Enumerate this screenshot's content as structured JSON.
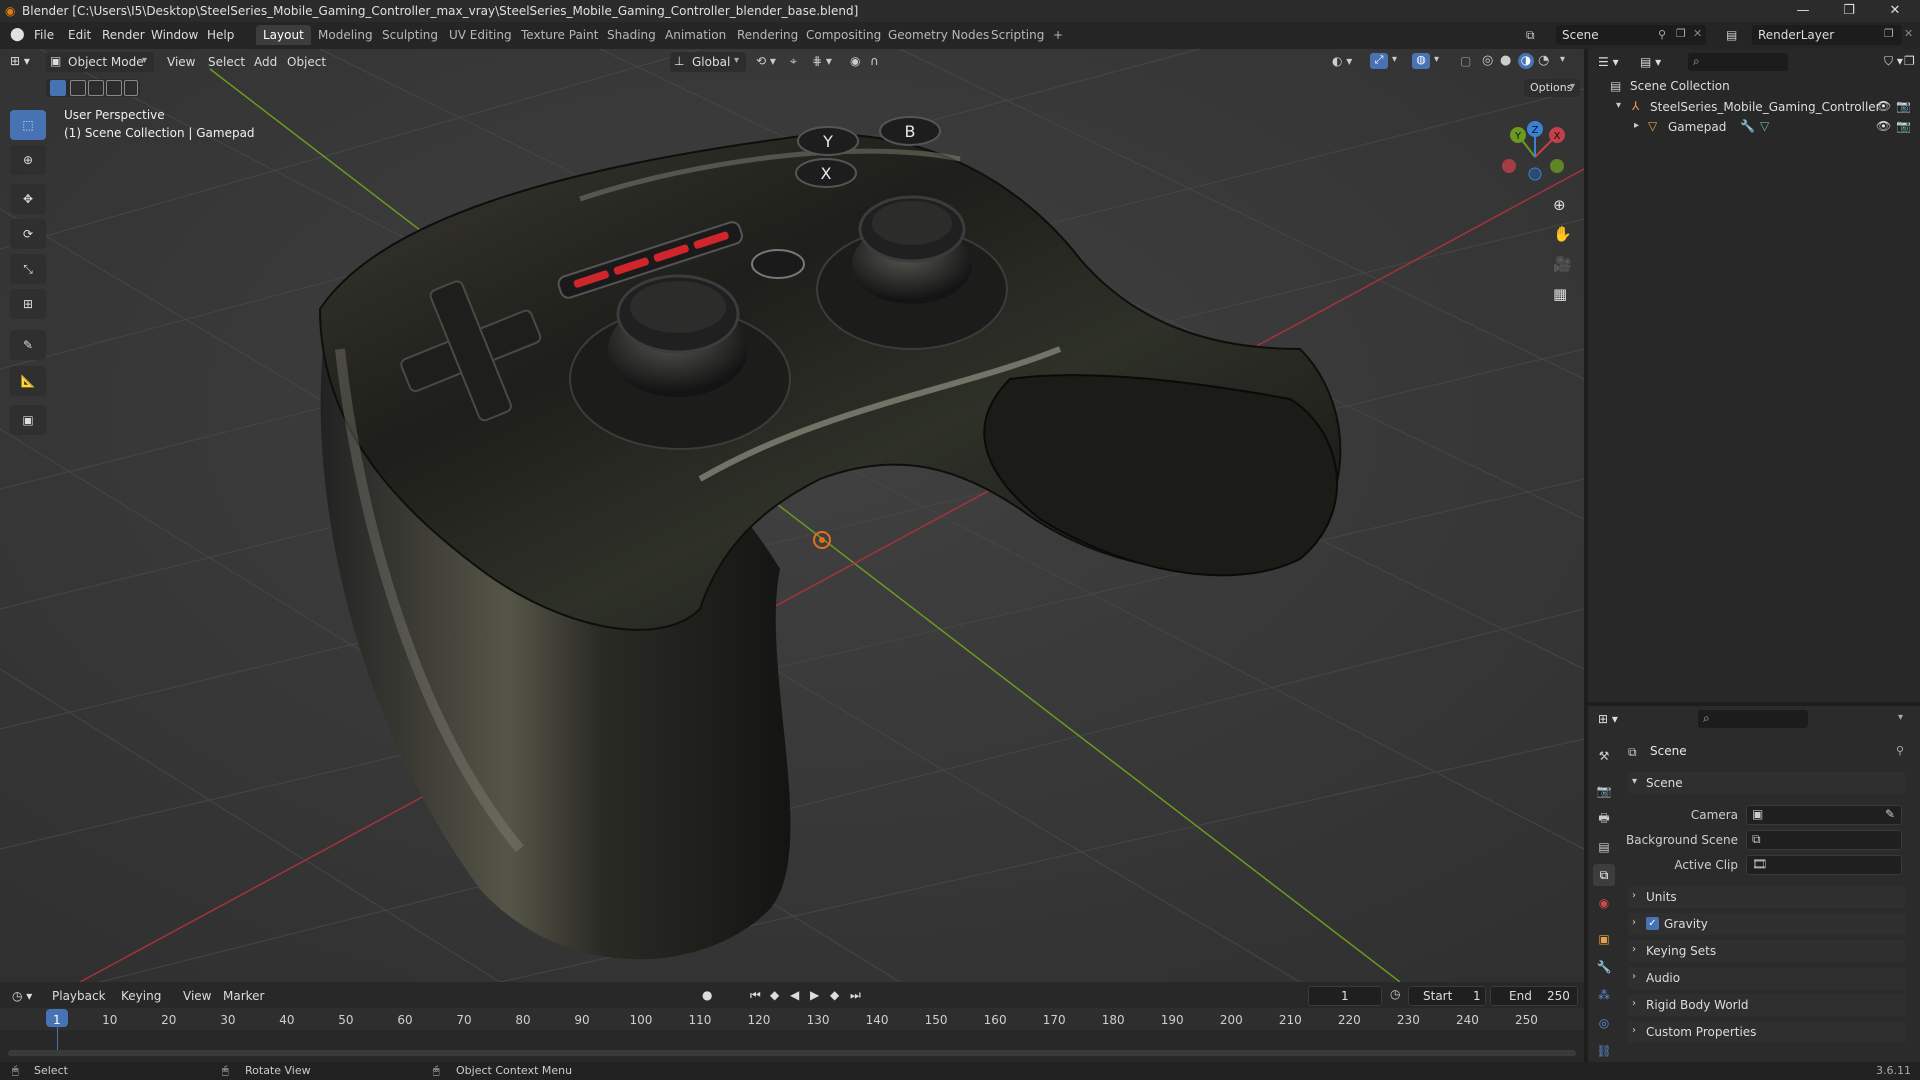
{
  "window": {
    "title": "Blender [C:\\Users\\I5\\Desktop\\SteelSeries_Mobile_Gaming_Controller_max_vray\\SteelSeries_Mobile_Gaming_Controller_blender_base.blend]",
    "minimize": "—",
    "maximize": "❐",
    "close": "✕"
  },
  "menu": [
    "File",
    "Edit",
    "Render",
    "Window",
    "Help"
  ],
  "workspaces": [
    "Layout",
    "Modeling",
    "Sculpting",
    "UV Editing",
    "Texture Paint",
    "Shading",
    "Animation",
    "Rendering",
    "Compositing",
    "Geometry Nodes",
    "Scripting"
  ],
  "add_workspace": "+",
  "scene_selector": {
    "label": "Scene"
  },
  "view_layer_selector": {
    "label": "RenderLayer"
  },
  "viewport": {
    "mode": "Object Mode",
    "menus": [
      "View",
      "Select",
      "Add",
      "Object"
    ],
    "transform_orientation": "Global",
    "options": "Options",
    "overlay_text_1": "User Perspective",
    "overlay_text_2": "(1) Scene Collection | Gamepad",
    "gizmo": {
      "x": "X",
      "y": "Y",
      "z": "Z"
    },
    "colors": {
      "x_axis": "#c2404a",
      "y_axis": "#6a9a22",
      "z_axis": "#3b82d6"
    }
  },
  "outliner": {
    "root": "Scene Collection",
    "items": [
      {
        "label": "SteelSeries_Mobile_Gaming_Controller"
      },
      {
        "label": "Gamepad"
      }
    ]
  },
  "properties": {
    "header": "Scene",
    "panel": "Scene",
    "fields": [
      {
        "label": "Camera"
      },
      {
        "label": "Background Scene"
      },
      {
        "label": "Active Clip"
      }
    ],
    "sections": [
      "Units",
      "Gravity",
      "Keying Sets",
      "Audio",
      "Rigid Body World",
      "Custom Properties"
    ],
    "gravity_checked": true
  },
  "timeline": {
    "menus": [
      "Playback",
      "Keying",
      "View",
      "Marker"
    ],
    "current_frame": "1",
    "start_label": "Start",
    "start": "1",
    "end_label": "End",
    "end": "250",
    "ticks": [
      "1",
      "10",
      "20",
      "30",
      "40",
      "50",
      "60",
      "70",
      "80",
      "90",
      "100",
      "110",
      "120",
      "130",
      "140",
      "150",
      "160",
      "170",
      "180",
      "190",
      "200",
      "210",
      "220",
      "230",
      "240",
      "250"
    ]
  },
  "statusbar": {
    "items": [
      "Select",
      "Rotate View",
      "Object Context Menu"
    ],
    "version": "3.6.11"
  }
}
